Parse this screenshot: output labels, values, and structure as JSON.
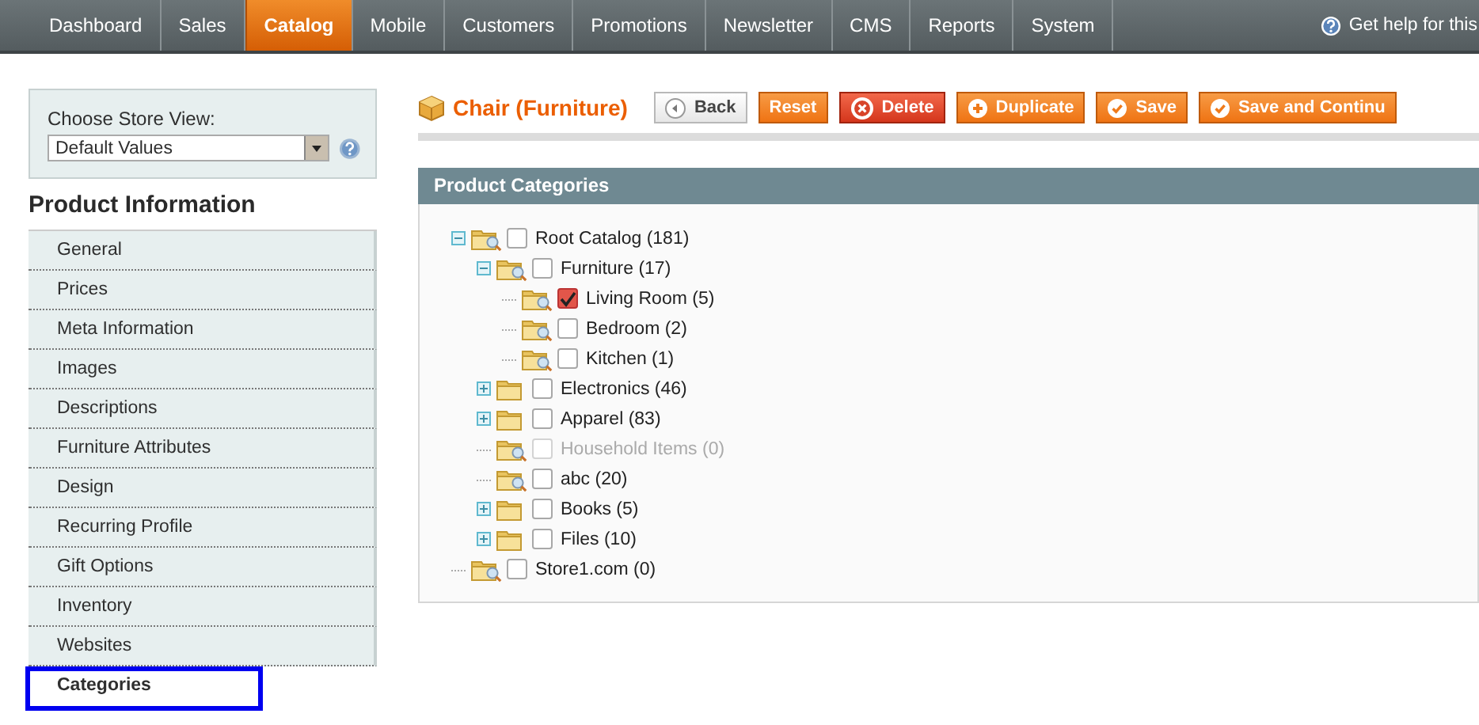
{
  "nav": {
    "tabs": [
      {
        "label": "Dashboard",
        "selected": false
      },
      {
        "label": "Sales",
        "selected": false
      },
      {
        "label": "Catalog",
        "selected": true
      },
      {
        "label": "Mobile",
        "selected": false
      },
      {
        "label": "Customers",
        "selected": false
      },
      {
        "label": "Promotions",
        "selected": false
      },
      {
        "label": "Newsletter",
        "selected": false
      },
      {
        "label": "CMS",
        "selected": false
      },
      {
        "label": "Reports",
        "selected": false
      },
      {
        "label": "System",
        "selected": false
      }
    ],
    "help": "Get help for this"
  },
  "store_view": {
    "label": "Choose Store View:",
    "value": "Default Values"
  },
  "sidebar": {
    "title": "Product Information",
    "items": [
      {
        "label": "General",
        "selected": false
      },
      {
        "label": "Prices",
        "selected": false
      },
      {
        "label": "Meta Information",
        "selected": false
      },
      {
        "label": "Images",
        "selected": false
      },
      {
        "label": "Descriptions",
        "selected": false
      },
      {
        "label": "Furniture Attributes",
        "selected": false
      },
      {
        "label": "Design",
        "selected": false
      },
      {
        "label": "Recurring Profile",
        "selected": false
      },
      {
        "label": "Gift Options",
        "selected": false
      },
      {
        "label": "Inventory",
        "selected": false
      },
      {
        "label": "Websites",
        "selected": false
      },
      {
        "label": "Categories",
        "selected": true
      }
    ]
  },
  "page": {
    "title": "Chair (Furniture)",
    "buttons": [
      {
        "label": "Back",
        "kind": "back"
      },
      {
        "label": "Reset",
        "kind": "plain"
      },
      {
        "label": "Delete",
        "kind": "delete"
      },
      {
        "label": "Duplicate",
        "kind": "add"
      },
      {
        "label": "Save",
        "kind": "save"
      },
      {
        "label": "Save and Continu",
        "kind": "save"
      }
    ]
  },
  "panel": {
    "title": "Product Categories",
    "tree": [
      {
        "label": "Root Catalog (181)",
        "collapsible": true,
        "expanded": true,
        "lens": true,
        "checked": false,
        "disabled": false,
        "children": [
          {
            "label": "Furniture (17)",
            "collapsible": true,
            "expanded": true,
            "lens": true,
            "checked": false,
            "disabled": false,
            "children": [
              {
                "label": "Living Room (5)",
                "collapsible": false,
                "expanded": false,
                "lens": true,
                "checked": true,
                "disabled": false
              },
              {
                "label": "Bedroom (2)",
                "collapsible": false,
                "expanded": false,
                "lens": true,
                "checked": false,
                "disabled": false
              },
              {
                "label": "Kitchen (1)",
                "collapsible": false,
                "expanded": false,
                "lens": true,
                "checked": false,
                "disabled": false
              }
            ]
          },
          {
            "label": "Electronics (46)",
            "collapsible": true,
            "expanded": false,
            "lens": false,
            "checked": false,
            "disabled": false
          },
          {
            "label": "Apparel (83)",
            "collapsible": true,
            "expanded": false,
            "lens": false,
            "checked": false,
            "disabled": false
          },
          {
            "label": "Household Items (0)",
            "collapsible": false,
            "expanded": false,
            "lens": true,
            "checked": false,
            "disabled": true
          },
          {
            "label": "abc (20)",
            "collapsible": false,
            "expanded": false,
            "lens": true,
            "checked": false,
            "disabled": false
          },
          {
            "label": "Books (5)",
            "collapsible": true,
            "expanded": false,
            "lens": false,
            "checked": false,
            "disabled": false
          },
          {
            "label": "Files (10)",
            "collapsible": true,
            "expanded": false,
            "lens": false,
            "checked": false,
            "disabled": false
          }
        ]
      },
      {
        "label": "Store1.com (0)",
        "collapsible": false,
        "expanded": false,
        "lens": true,
        "checked": false,
        "disabled": false
      }
    ]
  }
}
